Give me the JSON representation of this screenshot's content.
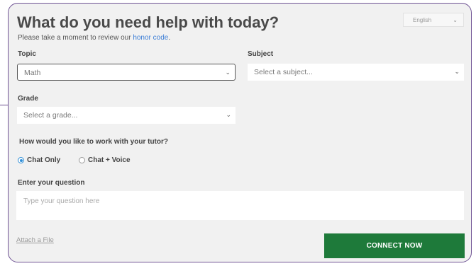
{
  "header": {
    "title": "What do you need help with today?",
    "subtitle_prefix": "Please take a moment to review our ",
    "honor_code_link": "honor code",
    "subtitle_suffix": ".",
    "language": "English",
    "language_icon": "chevron-down-icon"
  },
  "form": {
    "topic": {
      "label": "Topic",
      "value": "Math"
    },
    "subject": {
      "label": "Subject",
      "placeholder": "Select a subject..."
    },
    "grade": {
      "label": "Grade",
      "placeholder": "Select a grade..."
    },
    "work_mode": {
      "question": "How would you like to work with your tutor?",
      "options": [
        {
          "label": "Chat Only",
          "selected": true
        },
        {
          "label": "Chat + Voice",
          "selected": false
        }
      ]
    },
    "question": {
      "label": "Enter your question",
      "placeholder": "Type your question here"
    },
    "attach_label": "Attach a File",
    "connect_label": "CONNECT NOW"
  },
  "colors": {
    "accent_border": "#6f5394",
    "connect_button": "#1e7a3a",
    "link": "#3d7ed6",
    "radio_selected": "#2f8fd8"
  }
}
